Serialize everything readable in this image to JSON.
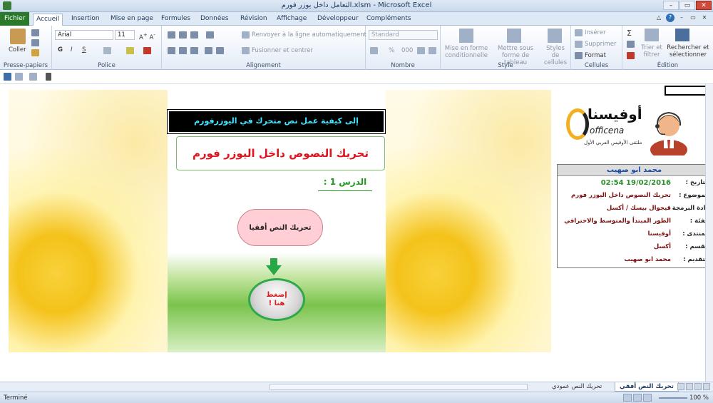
{
  "window": {
    "title": "التعامل داخل يوزر فورم.xlsm - Microsoft Excel"
  },
  "tabs": [
    {
      "label": "Fichier"
    },
    {
      "label": "Accueil"
    },
    {
      "label": "Insertion"
    },
    {
      "label": "Mise en page"
    },
    {
      "label": "Formules"
    },
    {
      "label": "Données"
    },
    {
      "label": "Révision"
    },
    {
      "label": "Affichage"
    },
    {
      "label": "Développeur"
    },
    {
      "label": "Compléments"
    }
  ],
  "ribbon": {
    "clipboard": {
      "paste": "Coller",
      "label": "Presse-papiers"
    },
    "font": {
      "name": "Arial",
      "size": "11",
      "bold": "G",
      "italic": "I",
      "underline": "S",
      "label": "Police"
    },
    "alignment": {
      "wrap": "Renvoyer à la ligne automatiquement",
      "merge": "Fusionner et centrer",
      "label": "Alignement"
    },
    "number": {
      "format": "Standard",
      "percent": "%",
      "thousands": "000",
      "label": "Nombre"
    },
    "style": {
      "conditional": "Mise en forme conditionnelle",
      "table": "Mettre sous forme de tableau",
      "cell_styles": "Styles de cellules",
      "label": "Style"
    },
    "cells": {
      "insert": "Insérer",
      "delete": "Supprimer",
      "format": "Format",
      "label": "Cellules"
    },
    "editing": {
      "sigma": "Σ",
      "sort": "Trier et filtrer",
      "find": "Rechercher et sélectionner",
      "label": "Édition"
    }
  },
  "sheet": {
    "headline": "إلى كيفية عمل نص متحرك في اليوزرفورم",
    "title": "تحريك النصوص داخل اليوزر فورم",
    "lesson": "الدرس 1  :",
    "cloud": "تحريك النص أفقيا",
    "button_line1": "إضغط",
    "button_line2": "هنا !"
  },
  "logo": {
    "arabic": "أوفيسنا",
    "english": "officena",
    "subtitle": "ملتقى الأوفيس العربي الأول"
  },
  "info": {
    "author_header": "محمد ابو صهيب",
    "rows": [
      {
        "label": "التاريخ :",
        "value": "19/02/2016 02:54"
      },
      {
        "label": "الموضوع :",
        "value": "تحريك النصوص داخل اليوزر فورم"
      },
      {
        "label": "مادة البرمجة :",
        "value": "فيجوال بيسك / أكسل"
      },
      {
        "label": "الفئة :",
        "value": "الطور المبتدأ والمتوسط والاحترافي"
      },
      {
        "label": "المنتدى :",
        "value": "أوفيسنا"
      },
      {
        "label": "القسم :",
        "value": "أكسل"
      },
      {
        "label": "التقديم :",
        "value": "محمد ابو صهيب"
      }
    ]
  },
  "sheet_tabs": [
    {
      "label": "تحريك النص أفقي"
    },
    {
      "label": "تحريك النص عمودي"
    }
  ],
  "status": {
    "ready": "Terminé",
    "zoom": "100 %"
  }
}
